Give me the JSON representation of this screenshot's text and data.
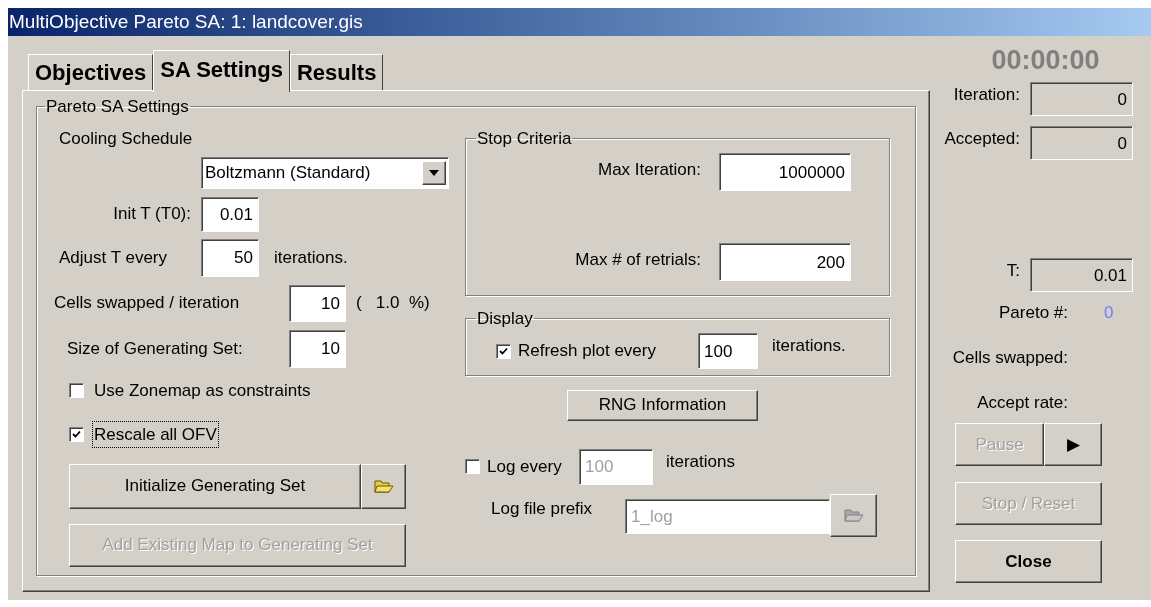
{
  "window": {
    "title": "MultiObjective Pareto SA: 1: landcover.gis"
  },
  "tabs": [
    {
      "label": "Objectives",
      "selected": false
    },
    {
      "label": "SA Settings",
      "selected": true
    },
    {
      "label": "Results",
      "selected": false
    }
  ],
  "settings": {
    "title": "Pareto SA Settings",
    "cooling_schedule": {
      "label": "Cooling Schedule",
      "value": "Boltzmann (Standard)"
    },
    "init_t": {
      "label": "Init T (T0):",
      "value": "0.01"
    },
    "adjust_t": {
      "label": "Adjust T every",
      "value": "50",
      "suffix": "iterations."
    },
    "cells_swapped": {
      "label": "Cells swapped / iteration",
      "value": "10",
      "percent": "(   1.0  %)"
    },
    "generating_set_size": {
      "label": "Size of Generating Set:",
      "value": "10"
    },
    "checkboxes": [
      {
        "label": "Use Zonemap as constraints",
        "checked": false,
        "focused": false
      },
      {
        "label": "Rescale all OFV",
        "checked": true,
        "focused": true
      }
    ],
    "initialize_button": {
      "label": "Initialize Generating Set",
      "disabled": false
    },
    "add_existing_button": {
      "label": "Add Existing Map to Generating Set",
      "disabled": true
    },
    "stop_criteria": {
      "title": "Stop Criteria",
      "fields": [
        {
          "label": "Max Iteration:",
          "value": "1000000"
        },
        {
          "label": "Max # of retrials:",
          "value": "200"
        }
      ]
    },
    "display": {
      "title": "Display",
      "label": "Refresh plot every",
      "checked": true,
      "value": "100",
      "suffix": "iterations."
    },
    "rng_button": "RNG Information",
    "log": {
      "label": "Log every",
      "checked": false,
      "disabled": true,
      "value": "100",
      "suffix": "iterations",
      "prefix_label": "Log file prefix",
      "prefix_value": "1_log"
    }
  },
  "status": {
    "timer": "00:00:00",
    "counters": [
      {
        "label": "Iteration:",
        "value": "0"
      },
      {
        "label": "Accepted:",
        "value": "0"
      }
    ],
    "temperature": {
      "label": "T:",
      "value": "0.01"
    },
    "pareto": {
      "label": "Pareto #:",
      "value": "0"
    },
    "cells_swapped": "Cells swapped:",
    "accept_rate": "Accept rate:"
  },
  "controls": {
    "pause": {
      "label": "Pause",
      "disabled": true
    },
    "play": {
      "label": "▶",
      "disabled": false
    },
    "stop": {
      "label": "Stop / Reset",
      "disabled": true
    },
    "close": {
      "label": "Close",
      "disabled": false
    }
  }
}
